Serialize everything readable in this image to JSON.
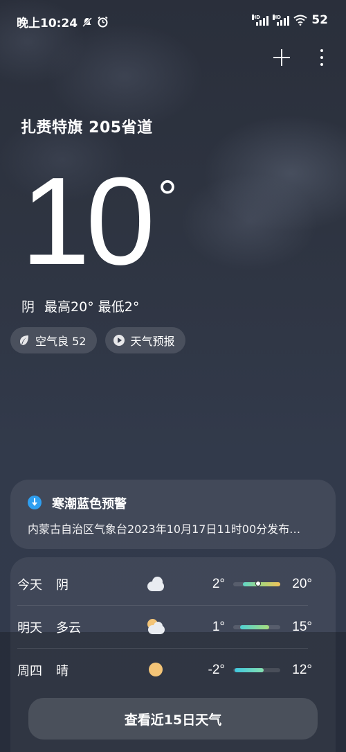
{
  "status_bar": {
    "time": "晚上10:24",
    "battery": "52",
    "icons": [
      "mute-icon",
      "alarm-icon",
      "signal-hd-icon",
      "signal-hd-icon",
      "wifi-icon"
    ]
  },
  "toolbar": {
    "icons": [
      "plus-icon",
      "more-icon"
    ]
  },
  "location": "扎赉特旗 205省道",
  "current": {
    "temperature": "10",
    "unit": "°",
    "condition": "阴",
    "range": "最高20° 最低2°"
  },
  "pills": {
    "air_quality": "空气良 52",
    "forecast_video": "天气预报"
  },
  "alert": {
    "title": "寒潮蓝色预警",
    "body": "内蒙古自治区气象台2023年10月17日11时00分发布…",
    "color": "#2f9ff0"
  },
  "forecast": [
    {
      "day": "今天",
      "condition": "阴",
      "icon": "cloudy-icon",
      "low": "2°",
      "high": "20°",
      "current_marker": true
    },
    {
      "day": "明天",
      "condition": "多云",
      "icon": "partly-cloudy-icon",
      "low": "1°",
      "high": "15°"
    },
    {
      "day": "周四",
      "condition": "晴",
      "icon": "sunny-icon",
      "low": "-2°",
      "high": "12°"
    }
  ],
  "cta": "查看近15日天气"
}
